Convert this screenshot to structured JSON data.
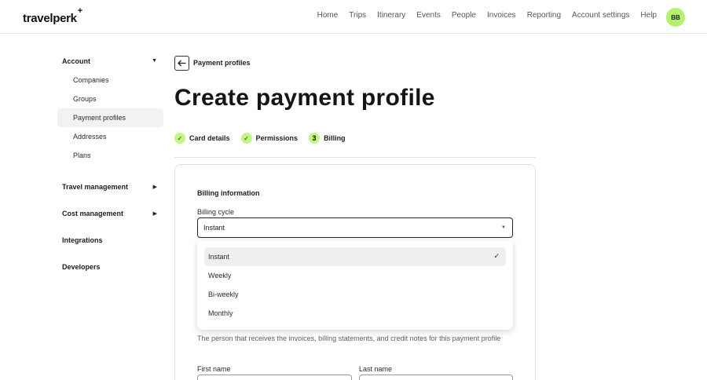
{
  "header": {
    "logo": "travelperk",
    "logo_mark": "+",
    "nav": [
      "Home",
      "Trips",
      "Itinerary",
      "Events",
      "People",
      "Invoices",
      "Reporting",
      "Account settings",
      "Help"
    ],
    "avatar_initials": "BB",
    "avatar_color": "#b3f26a"
  },
  "sidebar": {
    "account": {
      "label": "Account",
      "items": [
        "Companies",
        "Groups",
        "Payment profiles",
        "Addresses",
        "Plans"
      ],
      "active": "Payment profiles"
    },
    "travel_management": "Travel management",
    "cost_management": "Cost management",
    "integrations": "Integrations",
    "developers": "Developers"
  },
  "page": {
    "breadcrumb": "Payment profiles",
    "title": "Create payment profile",
    "steps": [
      {
        "label": "Card details",
        "status": "done"
      },
      {
        "label": "Permissions",
        "status": "done"
      },
      {
        "label": "Billing",
        "number": "3",
        "status": "current"
      }
    ],
    "step_color": "#c4f585"
  },
  "form": {
    "section_title": "Billing information",
    "billing_cycle_label": "Billing cycle",
    "billing_cycle_value": "Instant",
    "options": [
      "Instant",
      "Weekly",
      "Bi-weekly",
      "Monthly"
    ],
    "selected_option": "Instant",
    "contact_description": "The person that receives the invoices, billing statements, and credit notes for this payment profile",
    "first_name_label": "First name",
    "last_name_label": "Last name"
  }
}
